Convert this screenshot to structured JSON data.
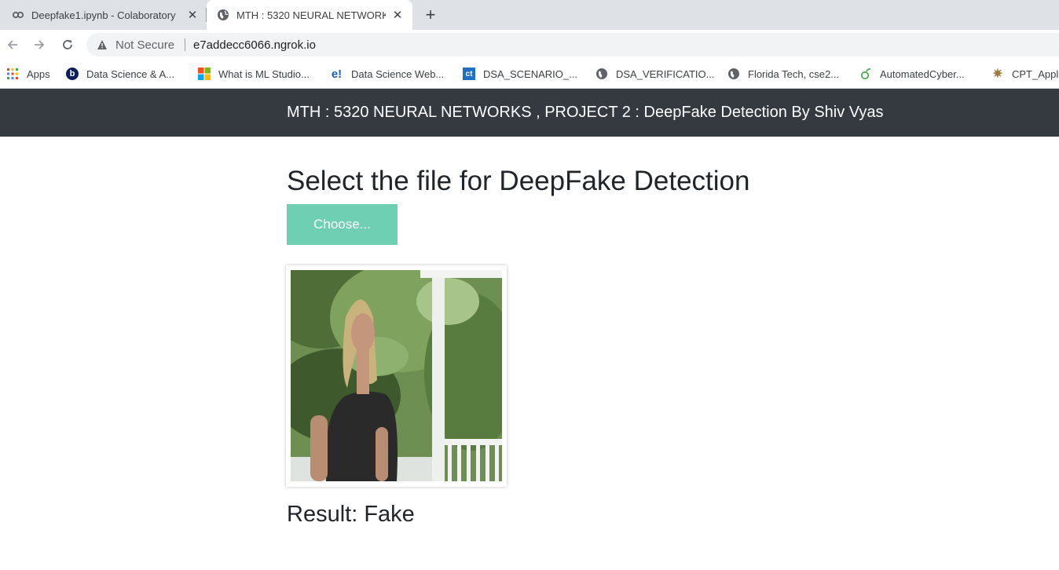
{
  "browser": {
    "tabs": [
      {
        "title": "Deepfake1.ipynb - Colaboratory",
        "icon": "colab-icon",
        "active": false
      },
      {
        "title": "MTH : 5320 NEURAL NETWORKS",
        "icon": "globe-icon",
        "active": true
      }
    ],
    "address": {
      "security_label": "Not Secure",
      "url": "e7addecc6066.ngrok.io"
    },
    "bookmarks": [
      {
        "label": "Apps",
        "icon": "apps-grid-icon"
      },
      {
        "label": "Data Science & A...",
        "icon": "b-circle-icon",
        "icon_text": "b"
      },
      {
        "label": "What is ML Studio...",
        "icon": "microsoft-icon"
      },
      {
        "label": "Data Science Web...",
        "icon": "e-exclaim-icon",
        "icon_text": "e!"
      },
      {
        "label": "DSA_SCENARIO_...",
        "icon": "ct-icon",
        "icon_text": "ct"
      },
      {
        "label": "DSA_VERIFICATIO...",
        "icon": "globe-icon"
      },
      {
        "label": "Florida Tech, cse2...",
        "icon": "globe-icon"
      },
      {
        "label": "AutomatedCyber...",
        "icon": "leaf-icon"
      },
      {
        "label": "CPT_Appl",
        "icon": "spark-icon"
      }
    ]
  },
  "navbar": {
    "title": "MTH : 5320 NEURAL NETWORKS , PROJECT 2 : DeepFake Detection By Shiv Vyas"
  },
  "main": {
    "heading": "Select the file for DeepFake Detection",
    "choose_label": "Choose...",
    "result_text": "Result: Fake"
  },
  "colors": {
    "navbar_bg": "#343a40",
    "choose_button": "#6fcfb3",
    "text": "#212529"
  }
}
